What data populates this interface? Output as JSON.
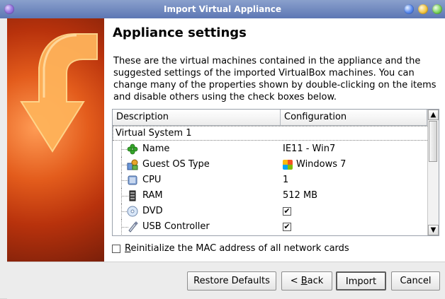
{
  "window": {
    "title": "Import Virtual Appliance"
  },
  "page": {
    "heading": "Appliance settings",
    "description": "These are the virtual machines contained in the appliance and the suggested settings of the imported VirtualBox machines. You can change many of the properties shown by double-clicking on the items and disable others using the check boxes below."
  },
  "table": {
    "columns": [
      "Description",
      "Configuration"
    ],
    "system": "Virtual System 1",
    "rows": [
      {
        "icon": "name-icon",
        "label": "Name",
        "value": "IE11 - Win7"
      },
      {
        "icon": "guest-os-icon",
        "label": "Guest OS Type",
        "value": "Windows 7"
      },
      {
        "icon": "cpu-icon",
        "label": "CPU",
        "value": "1"
      },
      {
        "icon": "ram-icon",
        "label": "RAM",
        "value": "512 MB"
      },
      {
        "icon": "dvd-icon",
        "label": "DVD",
        "checked": true
      },
      {
        "icon": "usb-icon",
        "label": "USB Controller",
        "checked": true
      }
    ]
  },
  "options": {
    "mac_checkbox_checked": false,
    "mac_label_prefix": "R",
    "mac_label_rest": "einitialize the MAC address of all network cards"
  },
  "buttons": {
    "restore": "Restore Defaults",
    "back_prefix": "< ",
    "back_mnemonic": "B",
    "back_rest": "ack",
    "import": "Import",
    "cancel": "Cancel"
  }
}
